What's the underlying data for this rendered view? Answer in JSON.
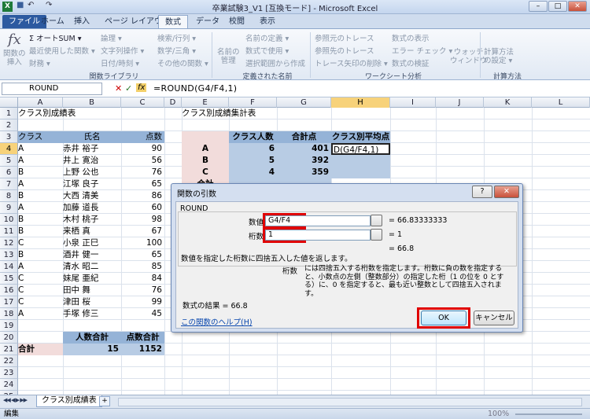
{
  "app": {
    "title": "卒業試験3_V1 [互換モード] - Microsoft Excel",
    "app_icon": "X",
    "undo": "↶",
    "redo": "↷",
    "save": "■",
    "minimize": "–",
    "maximize": "□",
    "close": "✕"
  },
  "tabs": [
    "ファイル",
    "ホーム",
    "挿入",
    "ページ レイアウト",
    "数式",
    "データ",
    "校閲",
    "表示"
  ],
  "ribbon": {
    "insert_function": "関数の\n挿入",
    "fx": "fx",
    "autosum": "Σ オートSUM ▾",
    "recent": "最近使用した関数 ▾",
    "financial": "財務 ▾",
    "logical": "論理 ▾",
    "text": "文字列操作 ▾",
    "datetime": "日付/時刻 ▾",
    "lookup": "検索/行列 ▾",
    "math": "数学/三角 ▾",
    "other": "その他の関数 ▾",
    "group_library": "関数ライブラリ",
    "name_mgr": "名前の\n管理",
    "define_name": "名前の定義 ▾",
    "use_in_formula": "数式で使用 ▾",
    "create_from_sel": "選択範囲から作成",
    "group_names": "定義された名前",
    "trace_prec": "参照元のトレース",
    "trace_dep": "参照先のトレース",
    "remove_arrows": "トレース矢印の削除 ▾",
    "show_formulas": "数式の表示",
    "error_check": "エラー チェック ▾",
    "evaluate": "数式の検証",
    "watch": "ウォッチ\nウィンドウ",
    "group_audit": "ワークシート分析",
    "calc_options": "計算方法\nの設定 ▾",
    "group_calc": "計算方法"
  },
  "formula_bar": {
    "name_box": "ROUND",
    "cancel": "✕",
    "enter": "✓",
    "fx": "fx",
    "formula": "=ROUND(G4/F4,1)"
  },
  "columns": [
    "A",
    "B",
    "C",
    "D",
    "E",
    "F",
    "G",
    "H",
    "I",
    "J",
    "K",
    "L"
  ],
  "rows": [
    "1",
    "2",
    "3",
    "4",
    "5",
    "6",
    "7",
    "8",
    "9",
    "10",
    "11",
    "12",
    "13",
    "14",
    "15",
    "16",
    "17",
    "18",
    "19",
    "20",
    "21",
    "22",
    "23",
    "24",
    "25"
  ],
  "sheet": {
    "title_left": "クラス別成績表",
    "title_right": "クラス別成績集計表",
    "hdr_class": "クラス",
    "hdr_name": "氏名",
    "hdr_score": "点数",
    "students": [
      {
        "cls": "A",
        "name": "赤井 裕子",
        "score": "90"
      },
      {
        "cls": "A",
        "name": "井上 寛治",
        "score": "56"
      },
      {
        "cls": "B",
        "name": "上野 公也",
        "score": "76"
      },
      {
        "cls": "A",
        "name": "江塚 良子",
        "score": "65"
      },
      {
        "cls": "B",
        "name": "大西 清美",
        "score": "86"
      },
      {
        "cls": "A",
        "name": "加藤 道長",
        "score": "60"
      },
      {
        "cls": "B",
        "name": "木村 桃子",
        "score": "98"
      },
      {
        "cls": "B",
        "name": "来栖 真",
        "score": "67"
      },
      {
        "cls": "C",
        "name": "小泉 正巳",
        "score": "100"
      },
      {
        "cls": "B",
        "name": "酒井 健一",
        "score": "65"
      },
      {
        "cls": "A",
        "name": "清水 昭二",
        "score": "85"
      },
      {
        "cls": "C",
        "name": "妹尾 亜紀",
        "score": "84"
      },
      {
        "cls": "C",
        "name": "田中 舞",
        "score": "76"
      },
      {
        "cls": "C",
        "name": "津田 桜",
        "score": "99"
      },
      {
        "cls": "A",
        "name": "手塚 修三",
        "score": "45"
      }
    ],
    "hdr_count_total": "人数合計",
    "hdr_score_total": "点数合計",
    "total_label": "合計",
    "count_total": "15",
    "score_total": "1152",
    "sum_hdr_count": "クラス人数",
    "sum_hdr_points": "合計点",
    "sum_hdr_avg": "クラス別平均点",
    "summary": [
      {
        "cls": "A",
        "count": "6",
        "points": "401",
        "avg": "D(G4/F4,1)"
      },
      {
        "cls": "B",
        "count": "5",
        "points": "392",
        "avg": ""
      },
      {
        "cls": "C",
        "count": "4",
        "points": "359",
        "avg": ""
      }
    ],
    "sum_total_label": "合計"
  },
  "dialog": {
    "title": "関数の引数",
    "help": "?",
    "close": "✕",
    "func": "ROUND",
    "arg1_label": "数値",
    "arg1_value": "G4/F4",
    "arg1_result": "= 66.83333333",
    "arg2_label": "桁数",
    "arg2_value": "1",
    "arg2_result": "= 1",
    "overall_result": "= 66.8",
    "desc": "数値を指定した桁数に四捨五入した値を返します。",
    "arg_desc_name": "桁数",
    "arg_desc": "には四捨五入する桁数を指定します。桁数に負の数を指定すると、小数点の左側（整数部分）の指定した桁（1 の位を 0 とする）に、0 を指定すると、最も近い整数として四捨五入されます。",
    "formula_result": "数式の結果 =  66.8",
    "help_link": "この関数のヘルプ(H)",
    "ok": "OK",
    "cancel": "キャンセル"
  },
  "sheet_tabs": {
    "nav": "◀◀ ◀ ▶ ▶▶",
    "active": "クラス別成績表",
    "new": "+"
  },
  "status": {
    "mode": "編集",
    "zoom": "100%"
  }
}
